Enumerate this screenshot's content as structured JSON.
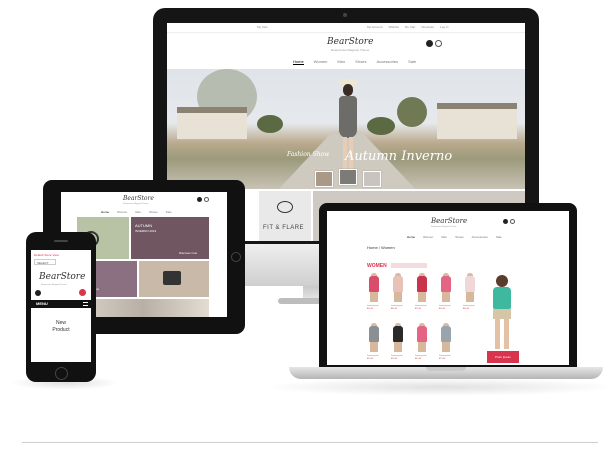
{
  "brand": {
    "logo": "BearStore",
    "tagline": "Responsive Magento Theme"
  },
  "desktop": {
    "topbar": {
      "left": "My Cart",
      "links": [
        "My Account",
        "Wishlist",
        "My Cart",
        "Checkout",
        "Log In"
      ]
    },
    "nav": [
      "Home",
      "Women",
      "Men",
      "Shoes",
      "Accessories",
      "Sale"
    ],
    "hero": {
      "small_caption": "Fashion Show",
      "big_caption": "Autumn Inverno"
    },
    "strip": {
      "label": "FIT & FLARE"
    }
  },
  "tablet": {
    "nav": [
      "Home",
      "Women",
      "Men",
      "Shoes",
      "Sale"
    ],
    "panels": [
      {
        "title": "AUTUMN",
        "subtitle": "INVERNO  2013",
        "button": "Discover now"
      },
      {
        "title": "",
        "subtitle": "",
        "button": "Discover now"
      }
    ]
  },
  "laptop": {
    "nav": [
      "Home",
      "Women",
      "Men",
      "Shoes",
      "Accessories",
      "Sale"
    ],
    "section_title": "WOMEN",
    "breadcrumb": "Home / Women",
    "promo_label": "Proin Ipsum",
    "products_row1": [
      {
        "name": "Lorem ipsum",
        "price": "$99.00",
        "color": "#d94c6b"
      },
      {
        "name": "Lorem ipsum",
        "price": "$89.00",
        "color": "#e8c2b6"
      },
      {
        "name": "Lorem ipsum",
        "price": "$79.00",
        "color": "#c9334b"
      },
      {
        "name": "Lorem ipsum",
        "price": "$99.00",
        "color": "#e46483"
      },
      {
        "name": "Lorem ipsum",
        "price": "$69.00",
        "color": "#f0d8d8"
      }
    ],
    "products_row2": [
      {
        "name": "Lorem ipsum",
        "price": "$59.00",
        "color": "#8a8f94"
      },
      {
        "name": "Lorem ipsum",
        "price": "$99.00",
        "color": "#2a2a2a"
      },
      {
        "name": "Lorem ipsum",
        "price": "$49.00",
        "color": "#e46483"
      },
      {
        "name": "Lorem ipsum",
        "price": "$79.00",
        "color": "#9aa4ad"
      }
    ]
  },
  "phone": {
    "lang_label": "Default Store View",
    "select_label": "SELECT",
    "logo": "BearStore",
    "tagline": "Responsive Magento Theme",
    "menu_label": "MENU",
    "new_product": "New\nProduct"
  },
  "colors": {
    "accent": "#d9344d",
    "tablet_panel": "#6f5661"
  }
}
